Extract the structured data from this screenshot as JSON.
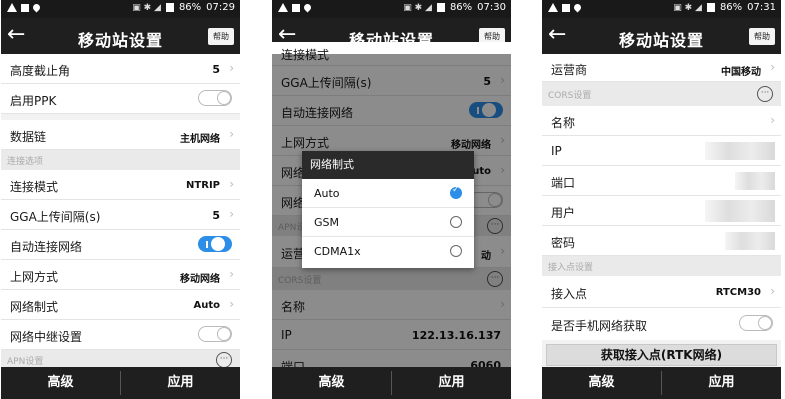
{
  "statusbar": {
    "battery": "86%",
    "times": [
      "07:29",
      "07:30",
      "07:31"
    ]
  },
  "header": {
    "back_icon": "←",
    "title": "移动站设置",
    "help_label": "帮助"
  },
  "footer": {
    "advanced_label": "高级",
    "apply_label": "应用"
  },
  "screen1": {
    "elevation_mask": {
      "label": "高度截止角",
      "value": "5"
    },
    "enable_ppk": {
      "label": "启用PPK"
    },
    "datalink": {
      "label": "数据链",
      "value": "主机网络"
    },
    "conn_section": "连接选项",
    "conn_mode": {
      "label": "连接模式",
      "value": "NTRIP"
    },
    "gga_interval": {
      "label": "GGA上传间隔(s)",
      "value": "5"
    },
    "auto_connect": {
      "label": "自动连接网络"
    },
    "internet_mode": {
      "label": "上网方式",
      "value": "移动网络"
    },
    "network_format": {
      "label": "网络制式",
      "value": "Auto"
    },
    "network_relay": {
      "label": "网络中继设置"
    },
    "apn_section": "APN设置"
  },
  "screen2": {
    "partial_top_label": "连接模式",
    "gga_interval": {
      "label": "GGA上传间隔(s)",
      "value": "5"
    },
    "auto_connect": {
      "label": "自动连接网络"
    },
    "internet_mode": {
      "label": "上网方式",
      "value": "移动网络"
    },
    "network_format_partial": {
      "label": "网络",
      "value": "uto"
    },
    "network_relay_partial": {
      "label": "网络"
    },
    "apn_section_partial": "APN设",
    "operator_partial": {
      "label": "运营",
      "value": "动"
    },
    "cors_section": "CORS设置",
    "name": {
      "label": "名称"
    },
    "ip": {
      "label": "IP",
      "value": "122.13.16.137"
    },
    "port_partial": {
      "label": "端口",
      "value": "6060"
    },
    "dialog": {
      "title": "网络制式",
      "options": [
        "Auto",
        "GSM",
        "CDMA1x"
      ],
      "selected": "Auto"
    }
  },
  "screen3": {
    "operator": {
      "label": "运营商",
      "value": "中国移动"
    },
    "cors_section": "CORS设置",
    "name": {
      "label": "名称"
    },
    "ip": {
      "label": "IP"
    },
    "port": {
      "label": "端口"
    },
    "user": {
      "label": "用户"
    },
    "password": {
      "label": "密码"
    },
    "mount_section": "接入点设置",
    "mountpoint": {
      "label": "接入点",
      "value": "RTCM30"
    },
    "phone_network": {
      "label": "是否手机网络获取"
    },
    "get_mountpoint_button": "获取接入点(RTK网络)"
  },
  "colors": {
    "accent": "#2d8ee8",
    "bar": "#1f1f1f",
    "section": "#eaeaea"
  }
}
